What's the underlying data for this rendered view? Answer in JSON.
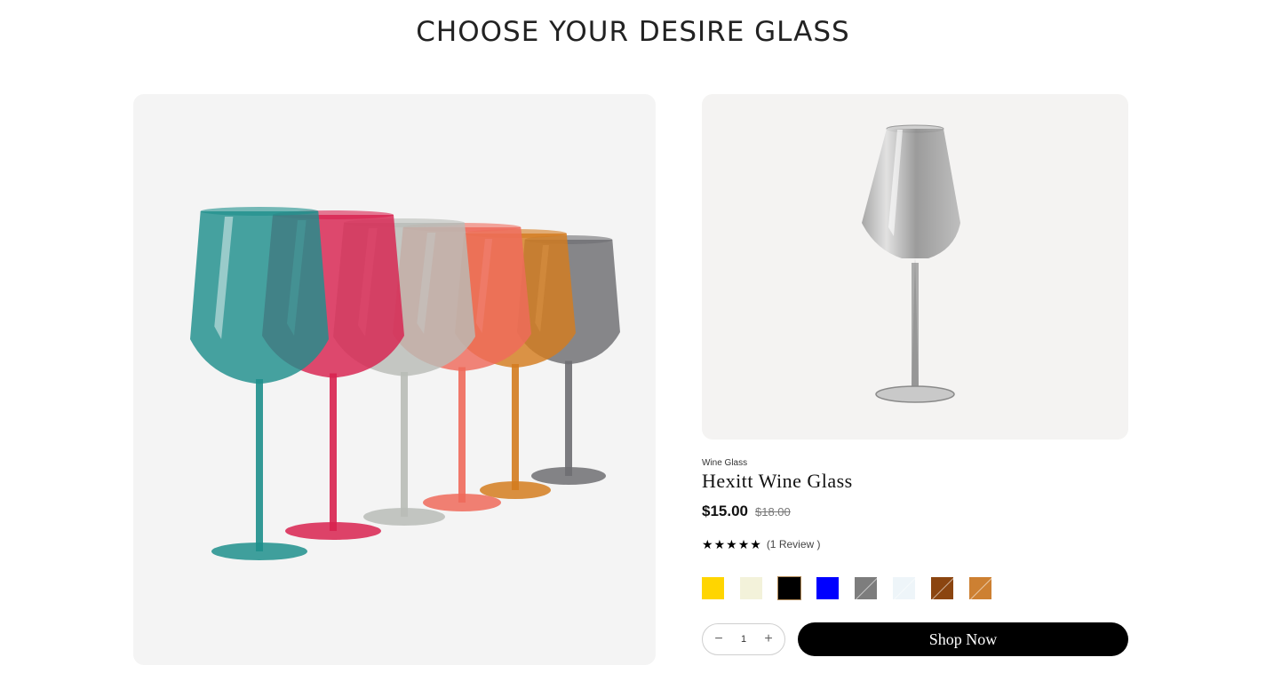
{
  "section": {
    "title": "CHOOSE YOUR DESIRE GLASS"
  },
  "hero": {
    "image_icon": "wine-glasses-lineup-image",
    "glass_colors": [
      "#6e6e72",
      "#d47c1f",
      "#ef6a5b",
      "#b9bcb7",
      "#d8224f",
      "#1e8f8c"
    ]
  },
  "product": {
    "image_icon": "single-grey-wine-glass-image",
    "category": "Wine Glass",
    "title": "Hexitt Wine Glass",
    "price": "$15.00",
    "compare_price": "$18.00",
    "rating": {
      "stars": 5,
      "star_glyph": "★",
      "review_text": "(1 Review )"
    },
    "swatches": [
      {
        "name": "yellow",
        "color": "#ffd500",
        "diagonal": false,
        "selected": false
      },
      {
        "name": "cream",
        "color": "#f3f2da",
        "diagonal": false,
        "selected": false
      },
      {
        "name": "black",
        "color": "#000000",
        "diagonal": false,
        "selected": true
      },
      {
        "name": "blue",
        "color": "#0000ff",
        "diagonal": false,
        "selected": false
      },
      {
        "name": "grey",
        "color": "#7d7d7d",
        "diagonal": true,
        "selected": false
      },
      {
        "name": "clear",
        "color": "#eef5f9",
        "diagonal": true,
        "selected": false
      },
      {
        "name": "brown",
        "color": "#8b4510",
        "diagonal": true,
        "selected": false
      },
      {
        "name": "amber",
        "color": "#cd8032",
        "diagonal": true,
        "selected": false
      }
    ],
    "quantity": {
      "minus_glyph": "−",
      "value": "1",
      "plus_glyph": "+"
    },
    "shop_button_label": "Shop Now"
  }
}
